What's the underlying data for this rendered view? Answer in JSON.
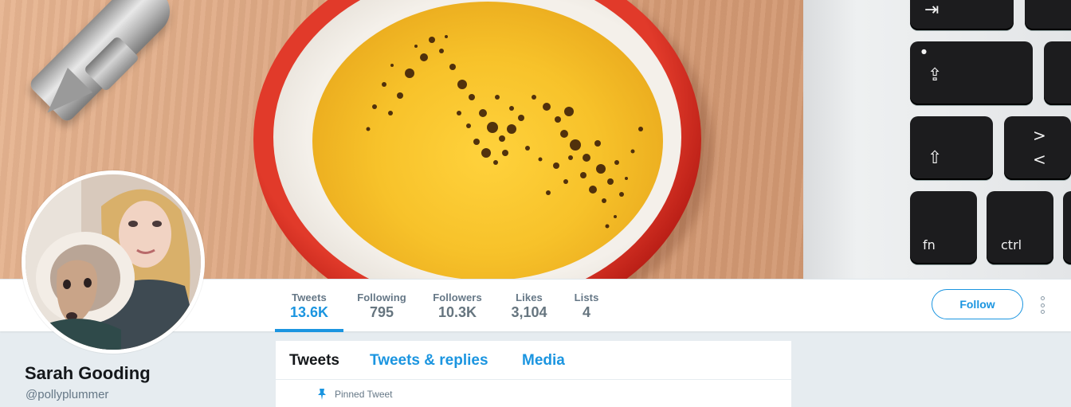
{
  "profile": {
    "name": "Sarah Gooding",
    "handle": "@pollyplummer"
  },
  "nav": {
    "stats": [
      {
        "label": "Tweets",
        "value": "13.6K"
      },
      {
        "label": "Following",
        "value": "795"
      },
      {
        "label": "Followers",
        "value": "10.3K"
      },
      {
        "label": "Likes",
        "value": "3,104"
      },
      {
        "label": "Lists",
        "value": "4"
      }
    ],
    "active_stat": "Tweets",
    "follow_label": "Follow",
    "more_icon": "more-vertical-icon"
  },
  "timeline": {
    "tabs": [
      {
        "label": "Tweets"
      },
      {
        "label": "Tweets & replies"
      },
      {
        "label": "Media"
      }
    ],
    "active_tab": "Tweets",
    "pinned_label": "Pinned Tweet",
    "pinned_icon": "pin-icon"
  },
  "banner": {
    "keys": [
      {
        "label": "⇥"
      },
      {
        "label": "⇪"
      },
      {
        "label": "⇧"
      },
      {
        "label": ">"
      },
      {
        "label": "<"
      },
      {
        "label": "fn"
      },
      {
        "label": "ctrl"
      }
    ]
  },
  "colors": {
    "accent": "#1b95e0",
    "text_primary": "#14171a",
    "text_secondary": "#657786",
    "page_background": "#e6ecf0"
  }
}
